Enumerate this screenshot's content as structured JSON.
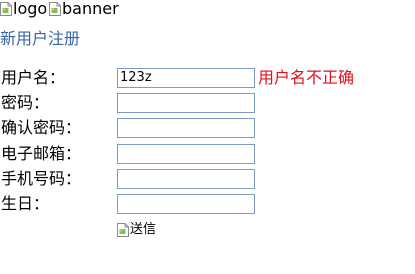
{
  "banner_area": {
    "logo_alt": "logo",
    "banner_alt": "banner"
  },
  "header": {
    "register_link": "新用户注册"
  },
  "form": {
    "fields": [
      {
        "label": "用户名：",
        "value": "123z"
      },
      {
        "label": "密码：",
        "value": ""
      },
      {
        "label": "确认密码：",
        "value": ""
      },
      {
        "label": "电子邮箱：",
        "value": ""
      },
      {
        "label": "手机号码：",
        "value": ""
      },
      {
        "label": "生日：",
        "value": ""
      }
    ],
    "username_error": "用户名不正确",
    "submit_alt": "送信"
  },
  "colors": {
    "link": "#3766a8",
    "error": "#e0101a",
    "input_border": "#7a9cc6"
  },
  "icons": {
    "broken_image": "broken-image-icon"
  }
}
